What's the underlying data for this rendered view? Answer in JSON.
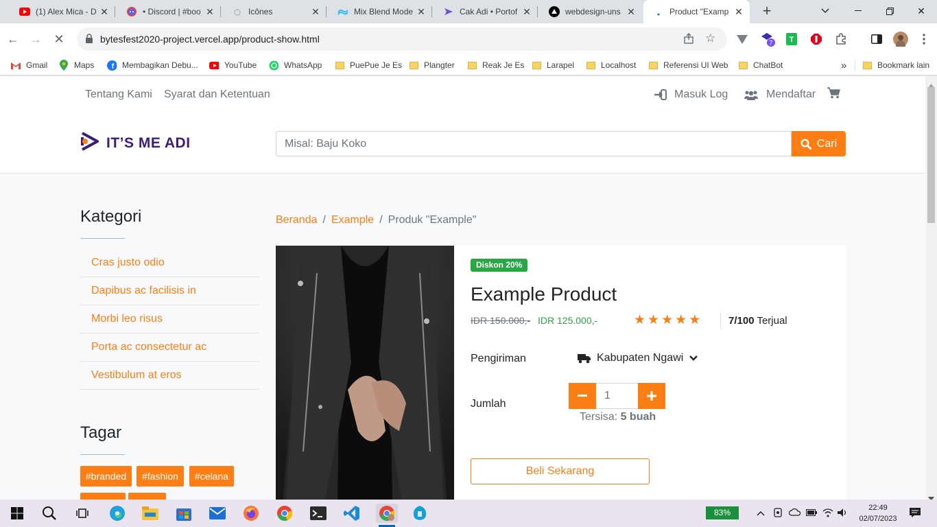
{
  "browser": {
    "tabs": [
      {
        "title": "(1) Alex Mica - D",
        "icon": "youtube-icon"
      },
      {
        "title": "• Discord | #boo",
        "icon": "discord-icon"
      },
      {
        "title": "Icônes",
        "icon": "icones-icon"
      },
      {
        "title": "Mix Blend Mode",
        "icon": "tailwind-icon"
      },
      {
        "title": "Cak Adi • Portof",
        "icon": "portfolio-icon"
      },
      {
        "title": "webdesign-uns",
        "icon": "vercel-icon"
      },
      {
        "title": "Product \"Examp",
        "icon": "loading-icon"
      }
    ],
    "new_tab": "+",
    "url": "bytesfest2020-project.vercel.app/product-show.html",
    "extension_badge": "7",
    "bookmarks": [
      {
        "label": "Gmail",
        "icon": "gmail-icon"
      },
      {
        "label": "Maps",
        "icon": "maps-icon"
      },
      {
        "label": "Membagikan Debu...",
        "icon": "facebook-icon"
      },
      {
        "label": "YouTube",
        "icon": "youtube-icon"
      },
      {
        "label": "WhatsApp",
        "icon": "whatsapp-icon"
      },
      {
        "label": "PuePue Je Es",
        "icon": "folder-icon"
      },
      {
        "label": "Plangter",
        "icon": "folder-icon"
      },
      {
        "label": "Reak Je Es",
        "icon": "folder-icon"
      },
      {
        "label": "Larapel",
        "icon": "folder-icon"
      },
      {
        "label": "Localhost",
        "icon": "folder-icon"
      },
      {
        "label": "Referensi UI Web",
        "icon": "folder-icon"
      },
      {
        "label": "ChatBot",
        "icon": "folder-icon"
      }
    ],
    "more_bookmarks": "»",
    "other_bookmarks": "Bookmark lain"
  },
  "site": {
    "top_links": [
      "Tentang Kami",
      "Syarat dan Ketentuan"
    ],
    "login": "Masuk Log",
    "register": "Mendaftar",
    "logo_text": "IT’S ME ADI",
    "search_placeholder": "Misal: Baju Koko",
    "search_button": "Cari",
    "accent_color": "#fd7e14"
  },
  "sidebar": {
    "categories_title": "Kategori",
    "categories": [
      "Cras justo odio",
      "Dapibus ac facilisis in",
      "Morbi leo risus",
      "Porta ac consectetur ac",
      "Vestibulum at eros"
    ],
    "tags_title": "Tagar",
    "tags": [
      "#branded",
      "#fashion",
      "#celana"
    ]
  },
  "breadcrumb": {
    "home": "Beranda",
    "category": "Example",
    "current": "Produk \"Example\"",
    "separator": "/"
  },
  "product": {
    "discount_badge": "Diskon 20%",
    "name": "Example Product",
    "old_price": "IDR 150.000,-",
    "new_price": "IDR 125.000,-",
    "rating": 5,
    "sold_count": "7/100",
    "sold_label": "Terjual",
    "shipping_label": "Pengiriman",
    "shipping_location": "Kabupaten Ngawi",
    "qty_label": "Jumlah",
    "qty_value": "1",
    "stock_label": "Tersisa:",
    "stock_value": "5 buah",
    "buy_button": "Beli Sekarang"
  },
  "taskbar": {
    "battery": "83%",
    "time": "22:49",
    "date": "02/07/2023"
  }
}
